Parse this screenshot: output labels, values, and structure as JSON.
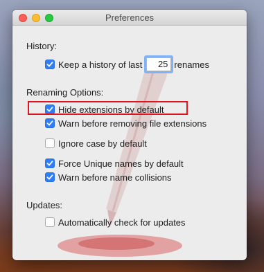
{
  "window": {
    "title": "Preferences"
  },
  "history": {
    "section_title": "History:",
    "keep_history_prefix": "Keep a history of last",
    "keep_history_value": "25",
    "keep_history_suffix": "renames",
    "checked": true
  },
  "renaming": {
    "section_title": "Renaming Options:",
    "options": [
      {
        "label": "Hide extensions by default",
        "checked": true
      },
      {
        "label": "Warn before removing file extensions",
        "checked": true
      },
      {
        "label": "Ignore case by default",
        "checked": false
      },
      {
        "label": "Force Unique names by default",
        "checked": true
      },
      {
        "label": "Warn before name collisions",
        "checked": true
      }
    ]
  },
  "updates": {
    "section_title": "Updates:",
    "options": [
      {
        "label": "Automatically check for updates",
        "checked": false
      }
    ]
  },
  "colors": {
    "checkbox_checked": "#2f7ef6",
    "highlight": "#e0151d",
    "close": "#fc5f57",
    "minimize": "#fdbc2e",
    "zoom": "#28c840"
  },
  "icons": {
    "checkmark": "checkmark-icon",
    "watermark": "quill-pen-icon"
  }
}
